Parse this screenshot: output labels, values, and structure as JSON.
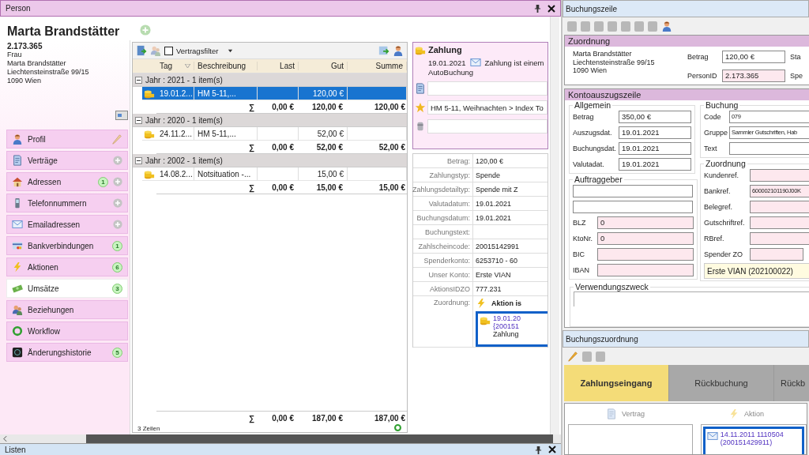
{
  "person": {
    "title": "Person",
    "name": "Marta Brandstätter",
    "number": "2.173.365",
    "address": [
      "Frau",
      "Marta Brandstätter",
      "Liechtensteinstraße 99/15",
      "1090 Wien"
    ],
    "nav": [
      {
        "label": "Profil",
        "selected": false
      },
      {
        "label": "Verträge",
        "selected": false
      },
      {
        "label": "Adressen",
        "badge": "1",
        "selected": false
      },
      {
        "label": "Telefonnummern",
        "selected": false
      },
      {
        "label": "Emailadressen",
        "selected": false
      },
      {
        "label": "Bankverbindungen",
        "badge": "1",
        "selected": false
      },
      {
        "label": "Aktionen",
        "badge": "6",
        "selected": false
      },
      {
        "label": "Umsätze",
        "badge": "3",
        "selected": true
      },
      {
        "label": "Beziehungen",
        "selected": false
      },
      {
        "label": "Workflow",
        "selected": false
      },
      {
        "label": "Änderungshistorie",
        "badge": "5",
        "selected": false
      }
    ]
  },
  "transactions": {
    "filter": {
      "label": "Vertragsfilter",
      "checked": false
    },
    "columns": [
      "Tag",
      "Beschreibung",
      "Last",
      "Gut",
      "Summe"
    ],
    "groups": [
      {
        "label": "Jahr : 2021 - 1 item(s)",
        "expanded": true,
        "rows": [
          {
            "tag": "19.01.2...",
            "beschreibung": "HM 5-11,...",
            "gut": "120,00 €",
            "selected": true
          }
        ],
        "total": {
          "symbol": "∑",
          "last": "0,00 €",
          "gut": "120,00 €",
          "summe": "120,00 €"
        }
      },
      {
        "label": "Jahr : 2020 - 1 item(s)",
        "expanded": true,
        "rows": [
          {
            "tag": "24.11.2...",
            "beschreibung": "HM 5-11,...",
            "gut": "52,00 €",
            "selected": false
          }
        ],
        "total": {
          "symbol": "∑",
          "last": "0,00 €",
          "gut": "52,00 €",
          "summe": "52,00 €"
        }
      },
      {
        "label": "Jahr : 2002 - 1 item(s)",
        "expanded": true,
        "rows": [
          {
            "tag": "14.08.2...",
            "beschreibung": "Notsituation -...",
            "gut": "15,00 €",
            "selected": false
          }
        ],
        "total": {
          "symbol": "∑",
          "last": "0,00 €",
          "gut": "15,00 €",
          "summe": "15,00 €"
        }
      }
    ],
    "grand_total": {
      "symbol": "∑",
      "last": "0,00 €",
      "gut": "187,00 €",
      "summe": "187,00 €"
    },
    "row_count": "3 Zeilen"
  },
  "payment": {
    "title": "Zahlung",
    "date": "19.01.2021",
    "message": "Zahlung ist einem",
    "source": "AutoBuchung",
    "linked_action": "HM 5-11, Weihnachten  >  Index To",
    "properties": [
      {
        "label": "Betrag:",
        "value": "120,00 €"
      },
      {
        "label": "Zahlungstyp:",
        "value": "Spende"
      },
      {
        "label": "Zahlungsdetailtyp:",
        "value": "Spende mit Z"
      },
      {
        "label": "Valutadatum:",
        "value": "19.01.2021"
      },
      {
        "label": "Buchungsdatum:",
        "value": "19.01.2021"
      },
      {
        "label": "Buchungstext:"
      },
      {
        "label": "Zahlscheincode:",
        "value": "20015142991"
      },
      {
        "label": "Spenderkonto:",
        "value": "6253710 - 60"
      },
      {
        "label": "Unser Konto:",
        "value": "Erste VIAN"
      },
      {
        "label": "AktionsIDZO",
        "value": "777.231"
      }
    ],
    "assignment": {
      "label": "Zuordnung:",
      "value": "Aktion is",
      "entry": [
        "19.01.20",
        "{200151",
        "Zahlung"
      ]
    }
  },
  "listen": {
    "title": "Listen"
  },
  "buchungszeile": {
    "title": "Buchungszeile",
    "zuordnung": {
      "title": "Zuordnung",
      "address": [
        "Marta Brandstätter",
        "Liechtensteinstraße 99/15",
        "1090 Wien"
      ],
      "fields": [
        {
          "label": "Betrag",
          "value": "120,00 €",
          "readonly": false,
          "next": "Sta"
        },
        {
          "label": "PersonID",
          "value": "2.173.365",
          "readonly": true,
          "next": "Spe"
        }
      ]
    },
    "kontoauszug": {
      "title": "Kontoauszugszeile",
      "allgemein": {
        "title": "Allgemein",
        "fields": [
          {
            "label": "Betrag",
            "value": "350,00 €",
            "readonly": false
          },
          {
            "label": "Auszugsdat.",
            "value": "19.01.2021",
            "readonly": false
          },
          {
            "label": "Buchungsdat.",
            "value": "19.01.2021",
            "readonly": false
          },
          {
            "label": "Valutadat.",
            "value": "19.01.2021",
            "readonly": false
          }
        ]
      },
      "auftraggeber": {
        "title": "Auftraggeber",
        "fields": [
          {
            "readonly": false
          },
          {
            "readonly": false
          },
          {
            "label": "BLZ",
            "value": "0",
            "readonly": true
          },
          {
            "label": "KtoNr.",
            "value": "0",
            "readonly": true
          },
          {
            "label": "BIC",
            "readonly": true
          },
          {
            "label": "IBAN",
            "readonly": true
          }
        ]
      },
      "buchung": {
        "title": "Buchung",
        "fields": [
          {
            "label": "Code",
            "value": "079",
            "readonly": false
          },
          {
            "label": "Gruppe",
            "value": "Sammler Gutschriften, Hab",
            "readonly": false
          },
          {
            "label": "Text",
            "readonly": false
          }
        ]
      },
      "zuordnung": {
        "title": "Zuordnung",
        "fields": [
          {
            "label": "Kundenref.",
            "readonly": true
          },
          {
            "label": "Bankref.",
            "value": "600002101190J00K",
            "readonly": true
          },
          {
            "label": "Belegref.",
            "readonly": true
          },
          {
            "label": "Gutschriftref.",
            "readonly": true
          },
          {
            "label": "RBref.",
            "readonly": true
          },
          {
            "label": "Spender ZO",
            "readonly": true
          }
        ],
        "account": "Erste VIAN (202100022)"
      },
      "verwendungszweck": {
        "title": "Verwendungszweck"
      }
    }
  },
  "buchungszuordnung": {
    "title": "Buchungszuordnung",
    "tabs": [
      {
        "label": "Zahlungseingang",
        "selected": true
      },
      {
        "label": "Rückbuchung",
        "selected": false
      },
      {
        "label": "Rückb",
        "selected": false
      }
    ],
    "columns": [
      {
        "label": "Vertrag"
      },
      {
        "label": "Aktion"
      }
    ],
    "entry": [
      "14.11.2011  1110504",
      "(200151429911)"
    ]
  }
}
